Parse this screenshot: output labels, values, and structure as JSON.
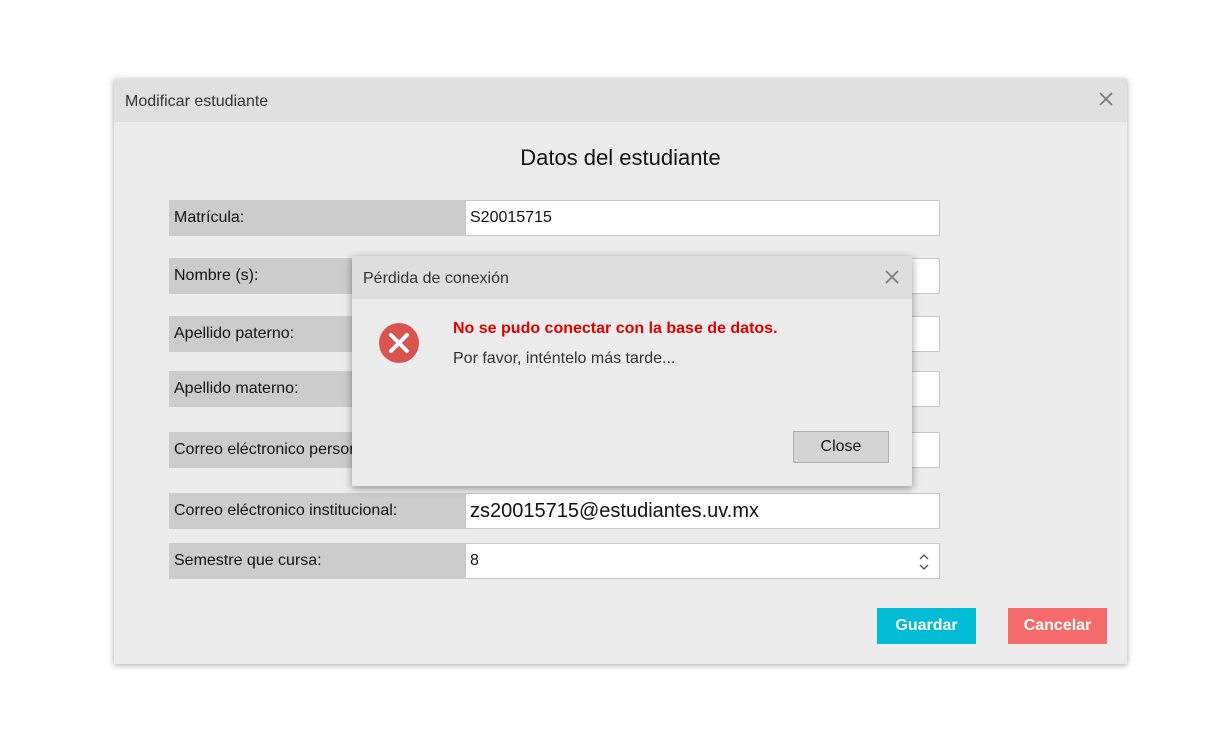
{
  "window": {
    "title": "Modificar estudiante"
  },
  "heading": "Datos del estudiante",
  "fields": [
    {
      "label": "Matrícula:",
      "value": "S20015715"
    },
    {
      "label": "Nombre (s):",
      "value": ""
    },
    {
      "label": "Apellido paterno:",
      "value": ""
    },
    {
      "label": "Apellido materno:",
      "value": ""
    },
    {
      "label": "Correo eléctronico personal:",
      "value": ""
    },
    {
      "label": "Correo eléctronico institucional:",
      "value": "zs20015715@estudiantes.uv.mx"
    },
    {
      "label": "Semestre que cursa:",
      "value": "8"
    }
  ],
  "buttons": {
    "save": "Guardar",
    "cancel": "Cancelar"
  },
  "dialog": {
    "title": "Pérdida de conexión",
    "message": "No se pudo conectar con la base de datos.",
    "detail": "Por favor, inténtelo más tarde...",
    "close": "Close",
    "icon": "error-icon"
  },
  "colors": {
    "save": "#00bcd4",
    "cancel": "#f56a6a",
    "error": "#e00000",
    "error_icon": "#d9534f"
  }
}
